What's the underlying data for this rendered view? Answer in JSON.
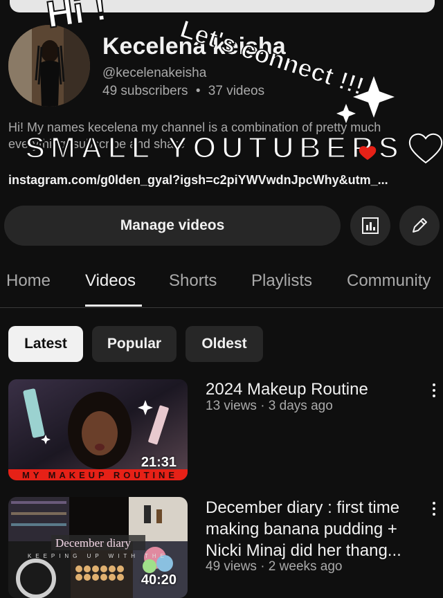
{
  "channel": {
    "name": "Kecelena keisha",
    "handle": "@kecelenakeisha",
    "subscribers": "49 subscribers",
    "videos_count": "37 videos",
    "stats_separator": "•",
    "description": "Hi! My names kecelena my channel is a combination of pretty much everything, subscribe and share",
    "link": "instagram.com/g0lden_gyal?igsh=c2piYWVwdnJpcWhy&utm_..."
  },
  "overlay": {
    "sticker_hi": "Hi !",
    "sticker_connect": "Let's connect !!!",
    "sticker_small_youtubers": "SMALL YOUTUBERS"
  },
  "actions": {
    "manage_label": "Manage videos",
    "analytics_icon": "analytics-icon",
    "edit_icon": "pencil-icon"
  },
  "tabs": [
    "Home",
    "Videos",
    "Shorts",
    "Playlists",
    "Community"
  ],
  "active_tab": "Videos",
  "filters": [
    "Latest",
    "Popular",
    "Oldest"
  ],
  "active_filter": "Latest",
  "videos": [
    {
      "title": "2024 Makeup Routine",
      "meta": "13 views · 3 days ago",
      "duration": "21:31",
      "thumb_caption": "MY MAKEUP ROUTINE"
    },
    {
      "title": "December diary : first time making banana pudding + Nicki Minaj did her thang...",
      "meta": "49 views · 2 weeks ago",
      "duration": "40:20",
      "thumb_caption": "December diary",
      "thumb_sub": "KEEPING UP WITH THE"
    }
  ],
  "colors": {
    "background": "#0f0f0f",
    "surface": "#272727",
    "text": "#f1f1f1",
    "secondary_text": "#aaaaaa",
    "accent_red": "#e62117"
  }
}
